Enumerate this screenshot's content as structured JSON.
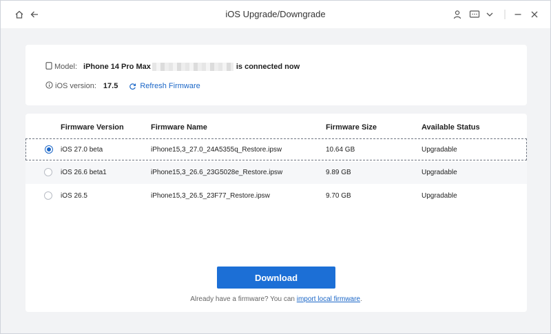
{
  "window": {
    "title": "iOS Upgrade/Downgrade"
  },
  "device": {
    "model_label": "Model:",
    "model_name": "iPhone 14 Pro Max",
    "connected_text": "is connected now",
    "ios_label": "iOS version:",
    "ios_value": "17.5",
    "refresh_label": "Refresh Firmware"
  },
  "table": {
    "headers": [
      "Firmware Version",
      "Firmware Name",
      "Firmware Size",
      "Available Status"
    ],
    "rows": [
      {
        "version": "iOS 27.0 beta",
        "name": "iPhone15,3_27.0_24A5355q_Restore.ipsw",
        "size": "10.64 GB",
        "status": "Upgradable",
        "selected": true
      },
      {
        "version": "iOS 26.6 beta1",
        "name": "iPhone15,3_26.6_23G5028e_Restore.ipsw",
        "size": "9.89 GB",
        "status": "Upgradable",
        "selected": false
      },
      {
        "version": "iOS 26.5",
        "name": "iPhone15,3_26.5_23F77_Restore.ipsw",
        "size": "9.70 GB",
        "status": "Upgradable",
        "selected": false
      }
    ]
  },
  "actions": {
    "download_label": "Download",
    "already_text": "Already have a firmware? You can",
    "import_label": "import local firmware",
    "period": "."
  },
  "colors": {
    "accent": "#1c6fd6",
    "background": "#f2f3f5"
  }
}
